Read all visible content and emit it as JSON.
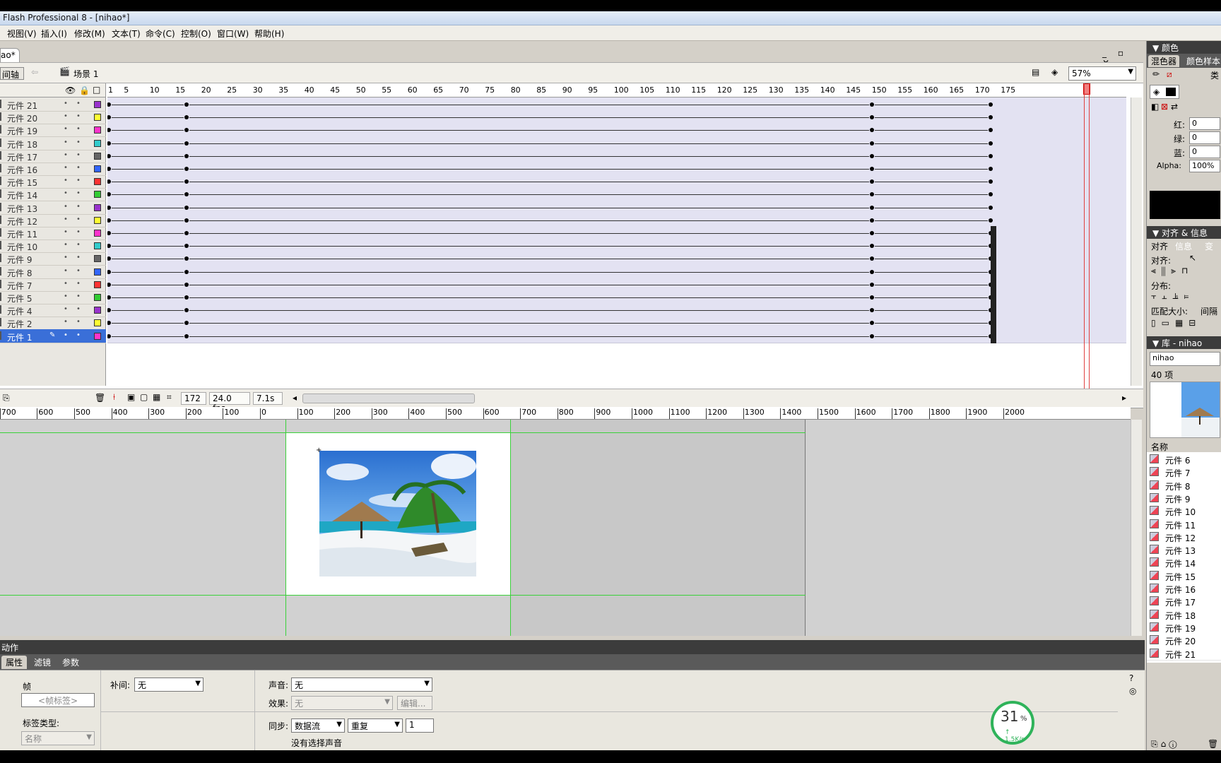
{
  "window": {
    "title": "Flash Professional 8 - [nihao*]"
  },
  "menu": [
    {
      "label": "视图(V)"
    },
    {
      "label": "插入(I)"
    },
    {
      "label": "修改(M)"
    },
    {
      "label": "文本(T)"
    },
    {
      "label": "命令(C)"
    },
    {
      "label": "控制(O)"
    },
    {
      "label": "窗口(W)"
    },
    {
      "label": "帮助(H)"
    }
  ],
  "document": {
    "tab_label": "ao*",
    "window_controls": "_ ▫ ✕"
  },
  "scene_bar": {
    "timeline_button": "间轴",
    "scene_label": "场景 1",
    "zoom": "57%"
  },
  "timeline": {
    "ruler_ticks": [
      "1",
      "5",
      "10",
      "15",
      "20",
      "25",
      "30",
      "35",
      "40",
      "45",
      "50",
      "55",
      "60",
      "65",
      "70",
      "75",
      "80",
      "85",
      "90",
      "95",
      "100",
      "105",
      "110",
      "115",
      "120",
      "125",
      "130",
      "135",
      "140",
      "145",
      "150",
      "155",
      "160",
      "165",
      "170",
      "175"
    ],
    "layers": [
      {
        "name": "元件 21",
        "color": "#9933cc"
      },
      {
        "name": "元件 20",
        "color": "#ffff33"
      },
      {
        "name": "元件 19",
        "color": "#ff33cc"
      },
      {
        "name": "元件 18",
        "color": "#33cccc"
      },
      {
        "name": "元件 17",
        "color": "#666666"
      },
      {
        "name": "元件 16",
        "color": "#3366ff"
      },
      {
        "name": "元件 15",
        "color": "#ff3333"
      },
      {
        "name": "元件 14",
        "color": "#33cc33"
      },
      {
        "name": "元件 13",
        "color": "#9933cc"
      },
      {
        "name": "元件 12",
        "color": "#ffff33"
      },
      {
        "name": "元件 11",
        "color": "#ff33cc"
      },
      {
        "name": "元件 10",
        "color": "#33cccc"
      },
      {
        "name": "元件 9",
        "color": "#666666"
      },
      {
        "name": "元件 8",
        "color": "#3366ff"
      },
      {
        "name": "元件 7",
        "color": "#ff3333"
      },
      {
        "name": "元件 5",
        "color": "#33cc33"
      },
      {
        "name": "元件 4",
        "color": "#9933cc"
      },
      {
        "name": "元件 2",
        "color": "#ffff33"
      },
      {
        "name": "元件 1",
        "color": "#ff33cc",
        "selected": true
      }
    ],
    "status": {
      "current_frame": "172",
      "fps": "24.0 fps",
      "time": "7.1s"
    }
  },
  "stage_ruler": [
    "700",
    "600",
    "500",
    "400",
    "300",
    "200",
    "100",
    "0",
    "100",
    "200",
    "300",
    "400",
    "500",
    "600",
    "700",
    "800",
    "900",
    "1000",
    "1100",
    "1200",
    "1300",
    "1400",
    "1500",
    "1600",
    "1700",
    "1800",
    "1900",
    "2000"
  ],
  "actions_panel": {
    "label": "动作"
  },
  "properties": {
    "tabs": [
      "属性",
      "滤镜",
      "参数"
    ],
    "frame_label": "帧",
    "frame_name_placeholder": "<帧标签>",
    "label_type_caption": "标签类型:",
    "label_type_value": "名称",
    "tween_caption": "补间:",
    "tween_value": "无",
    "sound_caption": "声音:",
    "sound_value": "无",
    "effect_caption": "效果:",
    "effect_value": "无",
    "edit_button": "编辑...",
    "sync_caption": "同步:",
    "sync_value": "数据流",
    "repeat_value": "重复",
    "repeat_count": "1",
    "no_sound_text": "没有选择声音"
  },
  "progress_widget": {
    "value": "31",
    "percent_sign": "%",
    "speed": "↑ 1.5K/s"
  },
  "color_panel": {
    "header": "▼ 颜色",
    "tabs": [
      "混色器",
      "颜色样本"
    ],
    "type_label": "类",
    "red_label": "红:",
    "red_value": "0",
    "green_label": "绿:",
    "green_value": "0",
    "blue_label": "蓝:",
    "blue_value": "0",
    "alpha_label": "Alpha:",
    "alpha_value": "100%"
  },
  "align_panel": {
    "header": "▼ 对齐 & 信息 &",
    "tabs": [
      "对齐",
      "信息",
      "变"
    ],
    "align_label": "对齐:",
    "distribute_label": "分布:",
    "match_size_label": "匹配大小:",
    "spacing_label": "间隔"
  },
  "library_panel": {
    "header": "▼ 库 - nihao",
    "doc_select": "nihao",
    "count": "40 项",
    "name_header": "名称",
    "items": [
      "元件 6",
      "元件 7",
      "元件 8",
      "元件 9",
      "元件 10",
      "元件 11",
      "元件 12",
      "元件 13",
      "元件 14",
      "元件 15",
      "元件 16",
      "元件 17",
      "元件 18",
      "元件 19",
      "元件 20",
      "元件 21"
    ]
  }
}
